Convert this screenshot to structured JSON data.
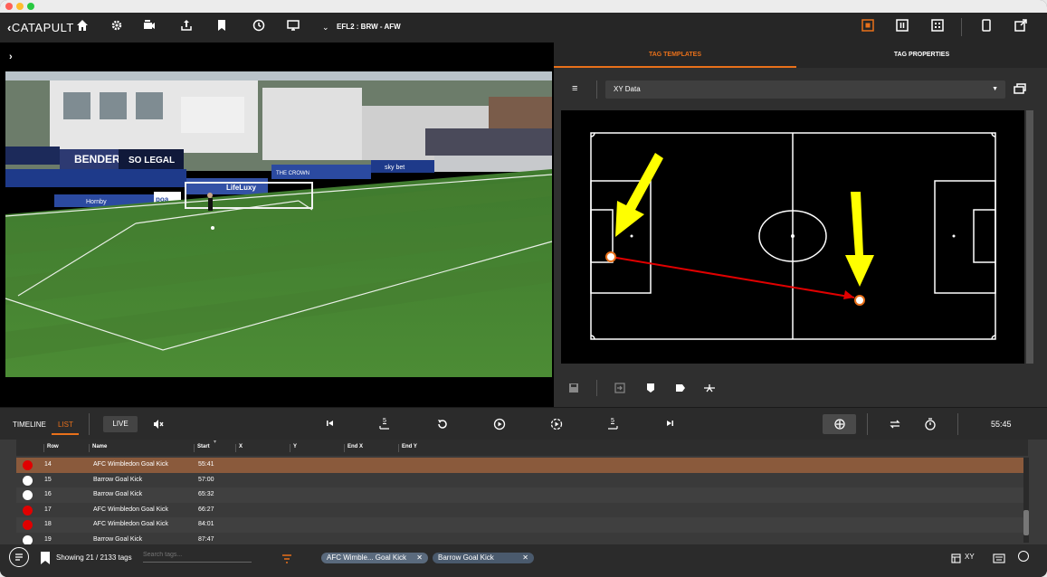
{
  "app": {
    "logo": "CATAPULT",
    "match_label": "EFL2 : BRW - AFW"
  },
  "colors": {
    "accent_orange": "#e8701a",
    "selected_row": "#8a5a3c",
    "red_dot": "#e00000",
    "arrow_yellow": "#ffff00",
    "arrow_red": "#e00000"
  },
  "toolbar_icons": [
    "home-icon",
    "gear-icon",
    "camera-icon",
    "upload-icon",
    "bookmark-icon",
    "clock-icon",
    "monitor-icon",
    "chevron-down-icon",
    "layout-single-icon",
    "layout-split-icon",
    "layout-grid-icon",
    "tablet-icon",
    "external-icon"
  ],
  "right_panel": {
    "tabs": [
      {
        "label": "TAG TEMPLATES",
        "active": true
      },
      {
        "label": "TAG PROPERTIES",
        "active": false
      }
    ],
    "dropdown_value": "XY Data"
  },
  "timeline": {
    "tab_timeline": "TIMELINE",
    "tab_list": "LIST",
    "live_label": "LIVE",
    "skip_back_label": "5",
    "skip_forward_label": "5",
    "time": "55:45"
  },
  "table": {
    "columns": [
      "Row",
      "Name",
      "Start",
      "X",
      "Y",
      "End X",
      "End Y"
    ],
    "rows": [
      {
        "row": "14",
        "name": "AFC Wimbledon Goal Kick",
        "start": "55:41",
        "color": "red",
        "selected": true
      },
      {
        "row": "15",
        "name": "Barrow Goal Kick",
        "start": "57:00",
        "color": "white",
        "selected": false
      },
      {
        "row": "16",
        "name": "Barrow Goal Kick",
        "start": "65:32",
        "color": "white",
        "selected": false
      },
      {
        "row": "17",
        "name": "AFC Wimbledon Goal Kick",
        "start": "66:27",
        "color": "red",
        "selected": false
      },
      {
        "row": "18",
        "name": "AFC Wimbledon Goal Kick",
        "start": "84:01",
        "color": "red",
        "selected": false
      },
      {
        "row": "19",
        "name": "Barrow Goal Kick",
        "start": "87:47",
        "color": "white",
        "selected": false
      }
    ]
  },
  "bottom_bar": {
    "showing": "Showing 21 / 2133 tags",
    "search_placeholder": "Search tags...",
    "filter_chips": [
      "AFC Wimble... Goal Kick",
      "Barrow Goal Kick"
    ],
    "xy_label": "XY"
  },
  "video": {
    "banners": [
      "BENDER",
      "SO LEGAL",
      "THE CROWN",
      "LifeLuxy",
      "sky bet",
      "Hornby",
      "poa"
    ]
  }
}
